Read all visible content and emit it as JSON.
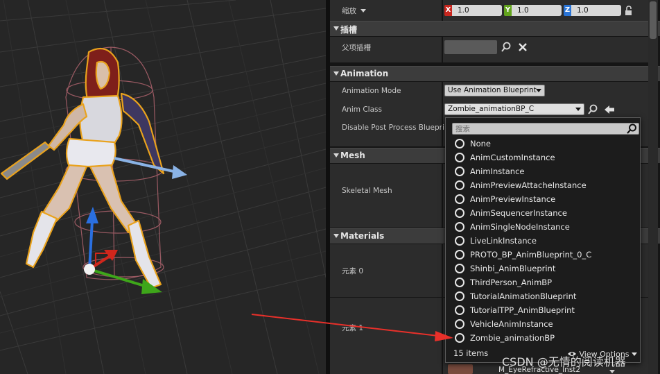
{
  "transform": {
    "scale_label": "缩放",
    "x_label": "X",
    "x_value": "1.0",
    "y_label": "Y",
    "y_value": "1.0",
    "z_label": "Z",
    "z_value": "1.0",
    "x_color": "#c8261e",
    "y_color": "#62a31c",
    "z_color": "#2a74d6"
  },
  "sockets": {
    "title": "插槽",
    "parent_socket_label": "父项插槽"
  },
  "animation": {
    "title": "Animation",
    "mode_label": "Animation Mode",
    "mode_value": "Use Animation Blueprint",
    "class_label": "Anim Class",
    "class_value": "Zombie_animationBP_C",
    "disable_post_label": "Disable Post Process Bluepri"
  },
  "mesh": {
    "title": "Mesh",
    "skeletal_mesh_label": "Skeletal Mesh"
  },
  "materials": {
    "title": "Materials",
    "element0_label": "元素 0",
    "element1_label": "元素 1",
    "material_name": "M_EyeRefractive_Inst2"
  },
  "popup": {
    "search_placeholder": "搜索",
    "items": [
      "None",
      "AnimCustomInstance",
      "AnimInstance",
      "AnimPreviewAttacheInstance",
      "AnimPreviewInstance",
      "AnimSequencerInstance",
      "AnimSingleNodeInstance",
      "LiveLinkInstance",
      "PROTO_BP_AnimBlueprint_0_C",
      "Shinbi_AnimBlueprint",
      "ThirdPerson_AnimBP",
      "TutorialAnimationBlueprint",
      "TutorialTPP_AnimBlueprint",
      "VehicleAnimInstance",
      "Zombie_animationBP"
    ],
    "count_label": "15 items",
    "view_options_label": "View Options"
  },
  "watermark": "CSDN @无情的阅读机器",
  "colors": {
    "annotation_arrow": "#e8302a",
    "selection_outline": "#e9a21d",
    "physics_body": "#b0646e"
  }
}
